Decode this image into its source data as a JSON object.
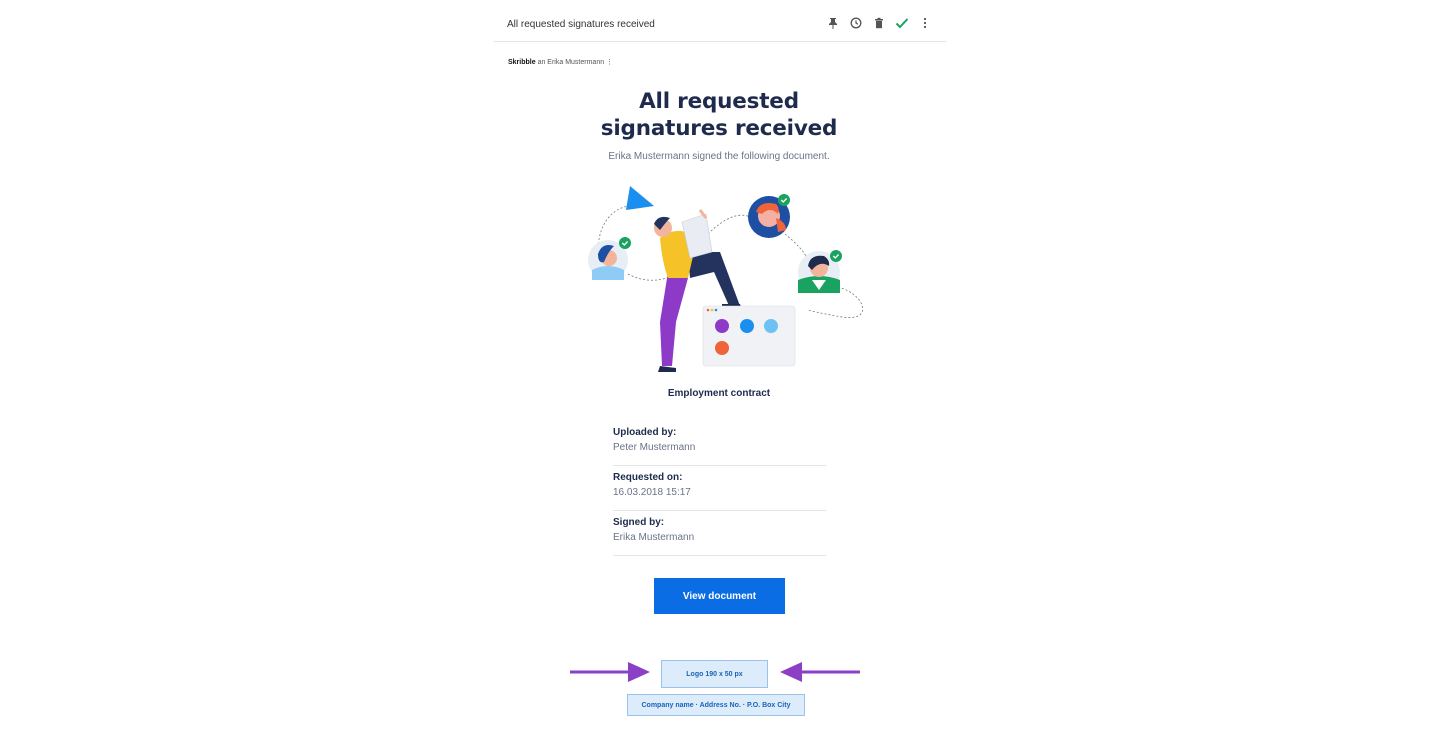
{
  "header": {
    "subject": "All requested signatures received",
    "actions": [
      {
        "name": "pin-icon",
        "glyph": "pin"
      },
      {
        "name": "clock-icon",
        "glyph": "clock"
      },
      {
        "name": "trash-icon",
        "glyph": "trash"
      },
      {
        "name": "check-icon",
        "glyph": "check"
      },
      {
        "name": "more-vertical-icon",
        "glyph": "more"
      }
    ]
  },
  "sender": {
    "name": "Skribble",
    "recipient_text": "an Erika Mustermann",
    "menu_glyph": "⋮"
  },
  "email": {
    "title_line1": "All requested",
    "title_line2": "signatures received",
    "intro": "Erika Mustermann signed the following document.",
    "document_name": "Employment contract",
    "details": [
      {
        "label": "Uploaded by:",
        "value": "Peter Mustermann"
      },
      {
        "label": "Requested on:",
        "value": "16.03.2018 15:17"
      },
      {
        "label": "Signed by:",
        "value": "Erika Mustermann"
      }
    ],
    "button_label": "View document"
  },
  "footer": {
    "logo_placeholder": "Logo 190 x 50 px",
    "company_line": "Company name · Address No. · P.O. Box City"
  },
  "colors": {
    "accent": "#0a6de4",
    "title": "#1f2b4d",
    "arrow": "#8b3fc4",
    "check": "#1aa260"
  }
}
